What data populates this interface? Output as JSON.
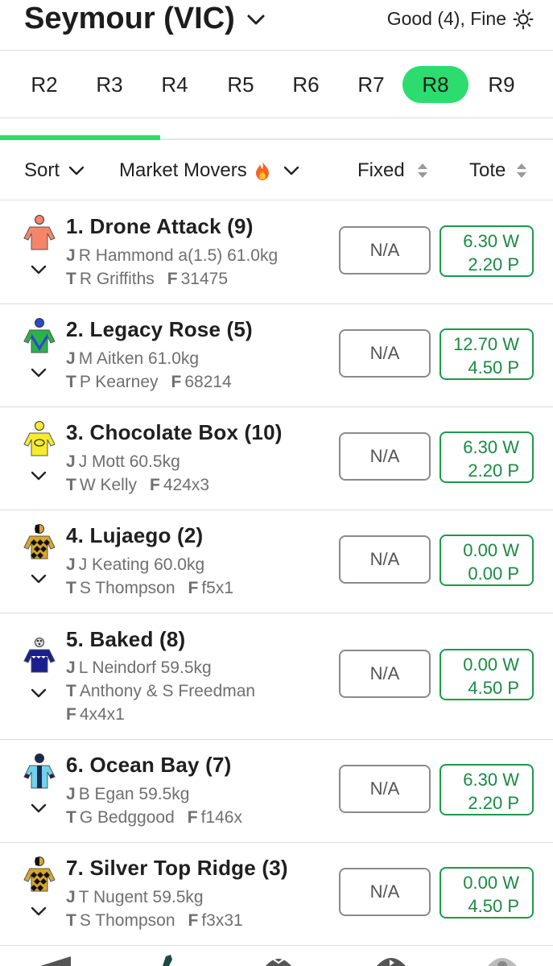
{
  "header": {
    "venue": "Seymour (VIC)",
    "conditions": "Good (4), Fine"
  },
  "races": [
    "R2",
    "R3",
    "R4",
    "R5",
    "R6",
    "R7",
    "R8",
    "R9"
  ],
  "active_race": "R8",
  "race_progress": 0.29,
  "sortbar": {
    "sort": "Sort",
    "movers": "Market Movers",
    "fixed": "Fixed",
    "tote": "Tote"
  },
  "runners": [
    {
      "name": "1. Drone Attack (9)",
      "jockey": "R Hammond a(1.5) 61.0kg",
      "trainer": "R Griffiths",
      "form": "31475",
      "fixed": "N/A",
      "win": "6.30 W",
      "place": "2.20 P"
    },
    {
      "name": "2. Legacy Rose (5)",
      "jockey": "M Aitken 61.0kg",
      "trainer": "P Kearney",
      "form": "68214",
      "fixed": "N/A",
      "win": "12.70 W",
      "place": "4.50 P"
    },
    {
      "name": "3. Chocolate Box (10)",
      "jockey": "J Mott 60.5kg",
      "trainer": "W Kelly",
      "form": "424x3",
      "fixed": "N/A",
      "win": "6.30 W",
      "place": "2.20 P"
    },
    {
      "name": "4. Lujaego (2)",
      "jockey": "J Keating 60.0kg",
      "trainer": "S Thompson",
      "form": "f5x1",
      "fixed": "N/A",
      "win": "0.00 W",
      "place": "0.00 P"
    },
    {
      "name": "5. Baked (8)",
      "jockey": "L Neindorf 59.5kg",
      "trainer": "Anthony & S Freedman",
      "form": "4x4x1",
      "fixed": "N/A",
      "win": "0.00 W",
      "place": "4.50 P"
    },
    {
      "name": "6. Ocean Bay (7)",
      "jockey": "B Egan 59.5kg",
      "trainer": "G Bedggood",
      "form": "f146x",
      "fixed": "N/A",
      "win": "6.30 W",
      "place": "2.20 P"
    },
    {
      "name": "7. Silver Top Ridge (3)",
      "jockey": "T Nugent 59.5kg",
      "trainer": "S Thompson",
      "form": "f3x31",
      "fixed": "N/A",
      "win": "0.00 W",
      "place": "4.50 P"
    }
  ],
  "labels": {
    "jockey_prefix": "J",
    "trainer_prefix": "T",
    "form_prefix": "F"
  },
  "colors": {
    "accent": "#2ddc6e",
    "tote_green": "#1b8a44"
  }
}
